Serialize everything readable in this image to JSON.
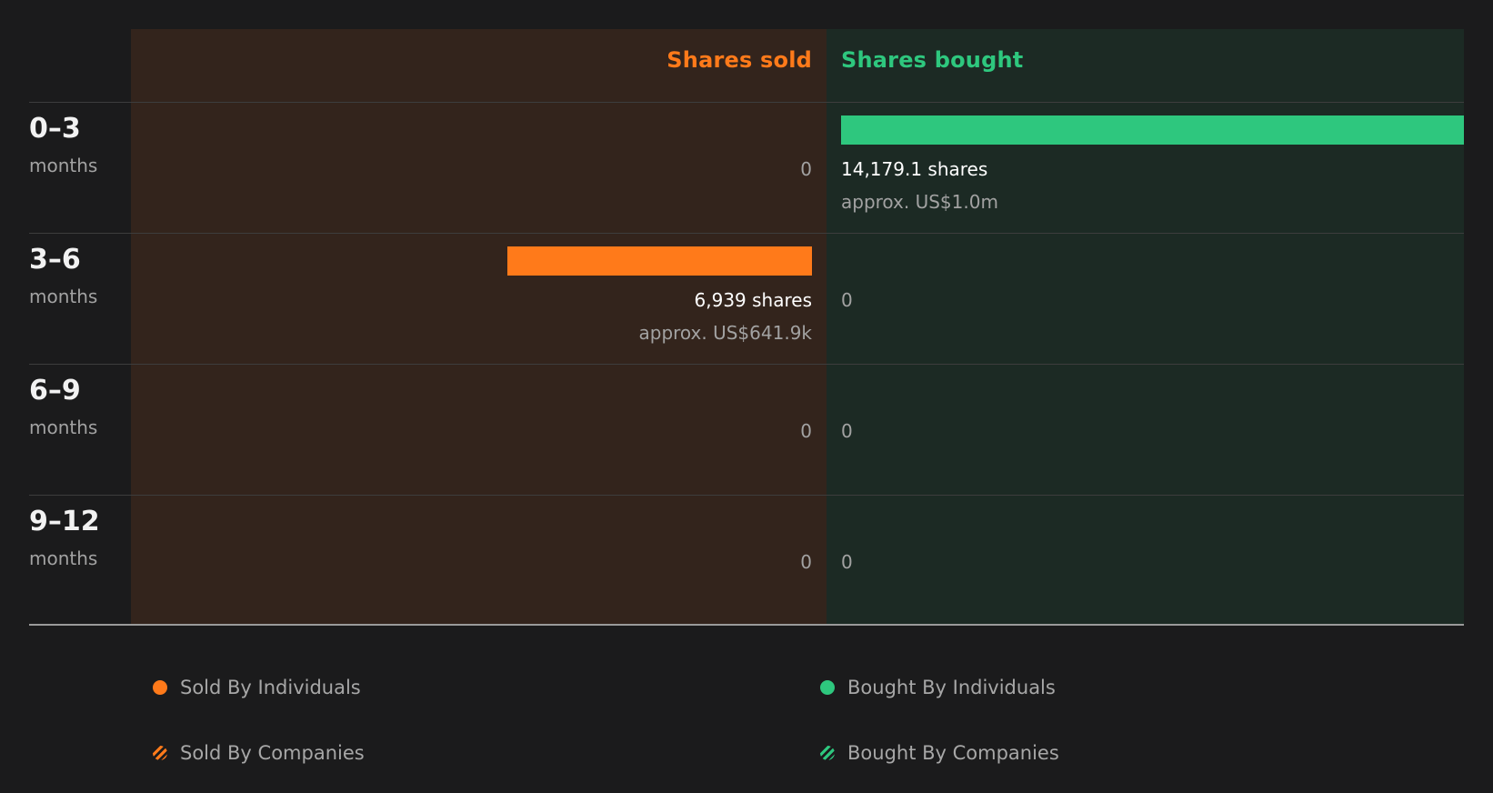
{
  "colors": {
    "sold": "#ff7a1a",
    "bought": "#2ec77e",
    "background": "#1b1b1c"
  },
  "headers": {
    "sold": "Shares sold",
    "bought": "Shares bought"
  },
  "chart_data": {
    "type": "bar",
    "orientation": "horizontal-diverging",
    "categories": [
      "0–3 months",
      "3–6 months",
      "6–9 months",
      "9–12 months"
    ],
    "series": [
      {
        "name": "Shares sold",
        "values": [
          0,
          6939,
          0,
          0
        ]
      },
      {
        "name": "Shares bought",
        "values": [
          14179.1,
          0,
          0,
          0
        ]
      }
    ],
    "legend_position": "bottom"
  },
  "rows": [
    {
      "period": "0–3",
      "unit": "months",
      "sold_label": "0",
      "sold_approx": "",
      "bought_label": "14,179.1 shares",
      "bought_approx": "approx. US$1.0m"
    },
    {
      "period": "3–6",
      "unit": "months",
      "sold_label": "6,939 shares",
      "sold_approx": "approx. US$641.9k",
      "bought_label": "0",
      "bought_approx": ""
    },
    {
      "period": "6–9",
      "unit": "months",
      "sold_label": "0",
      "sold_approx": "",
      "bought_label": "0",
      "bought_approx": ""
    },
    {
      "period": "9–12",
      "unit": "months",
      "sold_label": "0",
      "sold_approx": "",
      "bought_label": "0",
      "bought_approx": ""
    }
  ],
  "legend": {
    "sold_individuals": "Sold By Individuals",
    "sold_companies": "Sold By Companies",
    "bought_individuals": "Bought By Individuals",
    "bought_companies": "Bought By Companies"
  }
}
